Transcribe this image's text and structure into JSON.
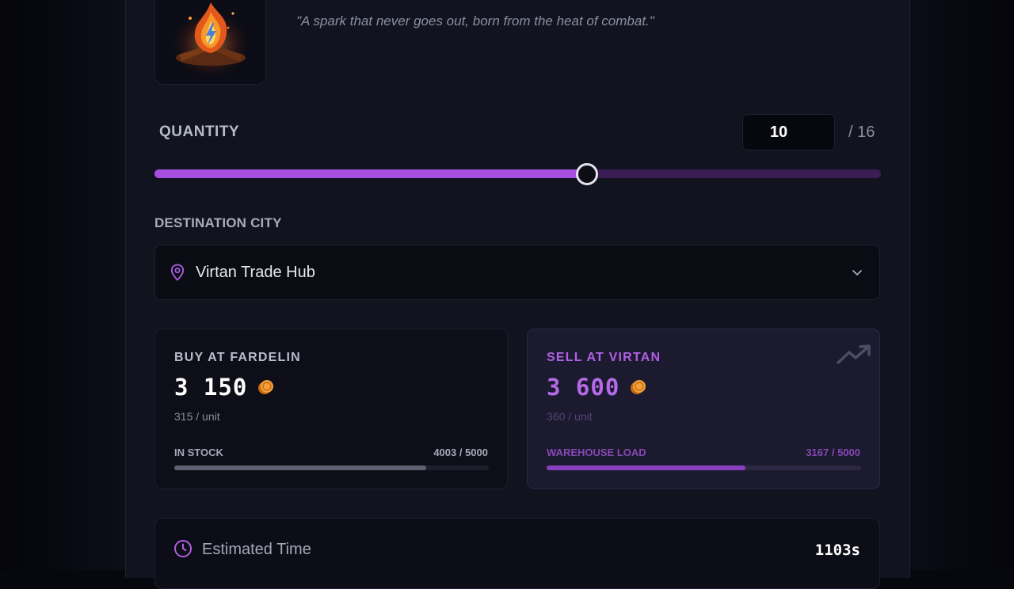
{
  "item": {
    "flavor_text": "\"A spark that never goes out, born from the heat of combat.\""
  },
  "quantity": {
    "label": "QUANTITY",
    "value": "10",
    "max_text": "/ 16",
    "current": 10,
    "max": 16,
    "slider_fraction": 0.595
  },
  "destination": {
    "label": "DESTINATION CITY",
    "selected_city": "Virtan Trade Hub",
    "pin_icon": "map-pin-icon",
    "dropdown_icon": "chevron-down-icon"
  },
  "buy": {
    "title": "BUY AT FARDELIN",
    "price": "3 150",
    "unit_price": "315 / unit",
    "stat_label": "IN STOCK",
    "stat_value": "4003 / 5000",
    "fill_fraction": 0.8006,
    "coin_icon": "gold-coin-icon"
  },
  "sell": {
    "title": "SELL AT VIRTAN",
    "price": "3 600",
    "unit_price": "360 / unit",
    "stat_label": "WAREHOUSE LOAD",
    "stat_value": "3167 / 5000",
    "fill_fraction": 0.6334,
    "coin_icon": "gold-coin-icon",
    "trend_icon": "trending-up-icon"
  },
  "estimate": {
    "label": "Estimated Time",
    "value": "1103s",
    "icon": "clock-icon"
  },
  "colors": {
    "accent": "#a64ee0",
    "panel": "#11131f",
    "background": "#07080e",
    "coin": "#e8891f"
  }
}
